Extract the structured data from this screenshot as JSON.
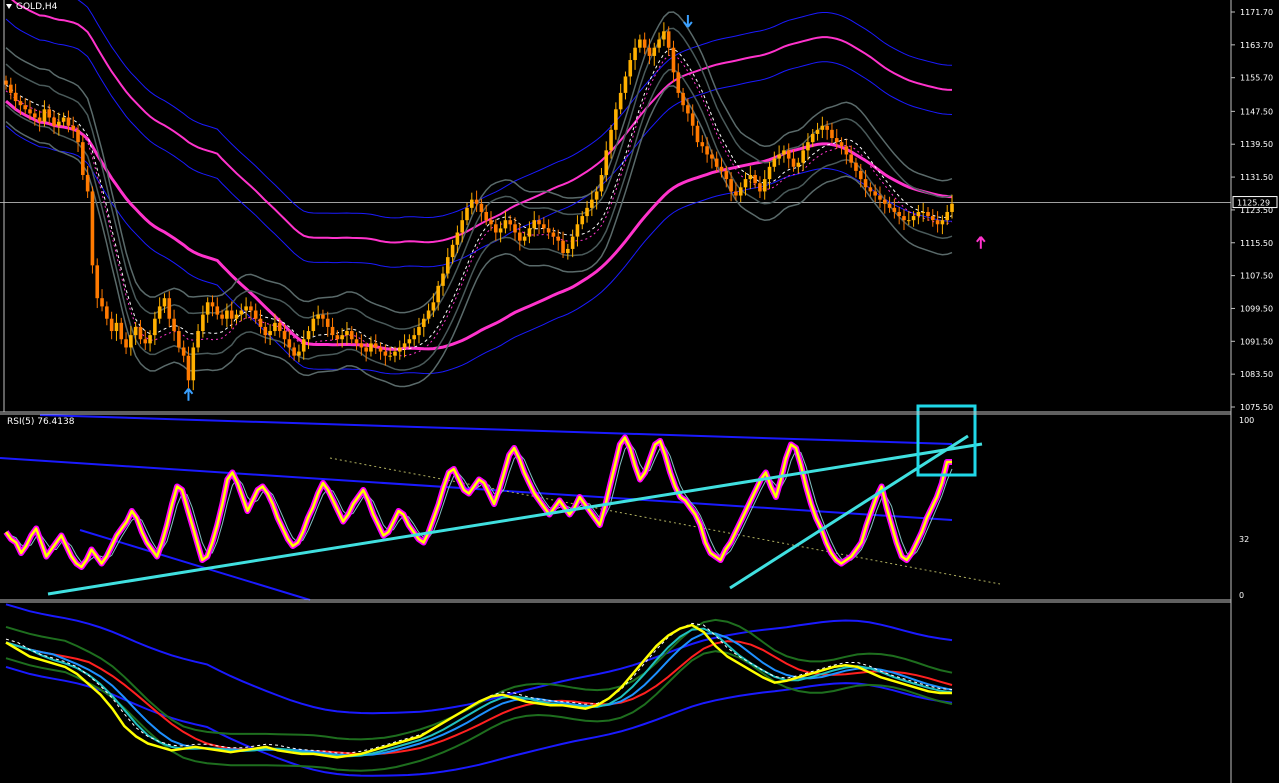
{
  "header": {
    "symbol": "GOLD,H4",
    "rsi_label": "RSI(5) 76.4138"
  },
  "colors": {
    "background": "#000000",
    "grid_frame": "#c0c0c0",
    "candle_up": "#ffb000",
    "candle_down": "#ff7a00",
    "envelope_magenta": "#ff33cc",
    "band_blue": "#1a1aff",
    "band_gray": "#5a6a6a",
    "rsi_yellow": "#ffff00",
    "rsi_magenta": "#ff00ff",
    "trend_cyan": "#40e0e0",
    "osc_red": "#ff2020",
    "osc_green": "#1e6e1e"
  },
  "chart_data": [
    {
      "type": "candlestick",
      "title": "GOLD,H4",
      "ylim": [
        1075.5,
        1171.7
      ],
      "price_ticks": [
        "1171.70",
        "1163.70",
        "1155.70",
        "1147.50",
        "1139.50",
        "1131.50",
        "1123.50",
        "1115.50",
        "1107.50",
        "1099.50",
        "1091.50",
        "1083.50",
        "1075.50"
      ],
      "current_price": "1125.29",
      "close_path": [
        1154,
        1152,
        1150,
        1149,
        1148,
        1147,
        1146,
        1145,
        1148,
        1146,
        1144,
        1145,
        1146,
        1144,
        1143,
        1140,
        1132,
        1128,
        1110,
        1102,
        1100,
        1097,
        1094,
        1096,
        1092,
        1090,
        1093,
        1095,
        1092,
        1091,
        1093,
        1097,
        1100,
        1102,
        1097,
        1094,
        1090,
        1088,
        1082,
        1090,
        1094,
        1098,
        1101,
        1100,
        1098,
        1097,
        1099,
        1097,
        1098,
        1099,
        1100,
        1099,
        1097,
        1095,
        1093,
        1094,
        1096,
        1094,
        1092,
        1090,
        1088,
        1089,
        1092,
        1094,
        1097,
        1098,
        1097,
        1095,
        1093,
        1092,
        1093,
        1094,
        1092,
        1091,
        1090,
        1089,
        1091,
        1090,
        1089,
        1088,
        1088,
        1089,
        1090,
        1091,
        1092,
        1093,
        1095,
        1097,
        1099,
        1101,
        1105,
        1108,
        1112,
        1115,
        1118,
        1121,
        1124,
        1126,
        1125,
        1123,
        1121,
        1120,
        1118,
        1119,
        1121,
        1120,
        1118,
        1116,
        1117,
        1119,
        1121,
        1120,
        1119,
        1118,
        1117,
        1116,
        1113,
        1114,
        1117,
        1120,
        1122,
        1124,
        1126,
        1128,
        1132,
        1138,
        1143,
        1148,
        1152,
        1156,
        1160,
        1163,
        1165,
        1163,
        1161,
        1163,
        1165,
        1167,
        1163,
        1157,
        1152,
        1149,
        1147,
        1144,
        1140,
        1139,
        1137,
        1136,
        1134,
        1133,
        1131,
        1128,
        1127,
        1129,
        1131,
        1132,
        1130,
        1128,
        1131,
        1134,
        1136,
        1137,
        1138,
        1136,
        1134,
        1135,
        1138,
        1140,
        1142,
        1143,
        1144,
        1143,
        1141,
        1140,
        1139,
        1137,
        1135,
        1133,
        1131,
        1129,
        1128,
        1127,
        1126,
        1125,
        1124,
        1123,
        1122,
        1121,
        1121,
        1122,
        1123,
        1123,
        1122,
        1121,
        1120,
        1121,
        1123,
        1125
      ],
      "markers": [
        {
          "type": "buy-arrow",
          "bar": 38,
          "price": 1078
        },
        {
          "type": "sell-arrow",
          "bar": 142,
          "price": 1170
        },
        {
          "type": "buy-arrow",
          "bar": 203,
          "price": 1115
        }
      ]
    },
    {
      "type": "line",
      "title": "RSI(5) 76.4138",
      "ylim": [
        0,
        100
      ],
      "levels": [
        "100",
        "32",
        "0"
      ],
      "series": [
        {
          "values": [
            36,
            32,
            30,
            24,
            28,
            34,
            38,
            30,
            22,
            26,
            30,
            34,
            28,
            22,
            18,
            16,
            20,
            26,
            22,
            18,
            22,
            28,
            34,
            38,
            42,
            48,
            44,
            36,
            30,
            26,
            22,
            30,
            40,
            52,
            62,
            60,
            50,
            40,
            30,
            20,
            22,
            30,
            40,
            52,
            66,
            70,
            64,
            56,
            48,
            54,
            60,
            62,
            58,
            52,
            44,
            38,
            32,
            28,
            30,
            36,
            44,
            50,
            58,
            64,
            60,
            54,
            48,
            42,
            46,
            52,
            56,
            60,
            54,
            46,
            40,
            34,
            36,
            42,
            48,
            46,
            40,
            36,
            32,
            30,
            36,
            44,
            52,
            62,
            70,
            72,
            66,
            60,
            58,
            62,
            66,
            64,
            58,
            52,
            60,
            70,
            80,
            84,
            78,
            70,
            64,
            58,
            54,
            50,
            46,
            50,
            54,
            50,
            46,
            50,
            56,
            52,
            48,
            44,
            40,
            50,
            62,
            74,
            86,
            90,
            84,
            74,
            66,
            70,
            78,
            86,
            88,
            80,
            70,
            62,
            56,
            54,
            50,
            46,
            40,
            30,
            24,
            22,
            20,
            26,
            30,
            36,
            42,
            48,
            54,
            60,
            66,
            70,
            62,
            56,
            66,
            78,
            86,
            84,
            74,
            62,
            52,
            44,
            38,
            30,
            24,
            20,
            18,
            20,
            22,
            26,
            30,
            40,
            48,
            56,
            62,
            50,
            40,
            30,
            22,
            20,
            24,
            30,
            36,
            44,
            50,
            56,
            64,
            76,
            76
          ]
        }
      ]
    },
    {
      "type": "line",
      "title": "",
      "ylim": [
        1075,
        1175
      ],
      "series": [
        {
          "values": [
            1154,
            1150,
            1146,
            1144,
            1142,
            1140,
            1136,
            1130,
            1124,
            1116,
            1106,
            1100,
            1096,
            1094,
            1092,
            1093,
            1094,
            1093,
            1092,
            1091,
            1092,
            1093,
            1094,
            1092,
            1091,
            1090,
            1090,
            1089,
            1088,
            1089,
            1090,
            1092,
            1094,
            1096,
            1098,
            1100,
            1104,
            1108,
            1112,
            1116,
            1120,
            1123,
            1124,
            1122,
            1120,
            1119,
            1118,
            1118,
            1117,
            1116,
            1118,
            1122,
            1128,
            1136,
            1144,
            1152,
            1158,
            1162,
            1164,
            1160,
            1152,
            1146,
            1142,
            1138,
            1134,
            1131,
            1132,
            1134,
            1136,
            1138,
            1140,
            1141,
            1140,
            1137,
            1134,
            1132,
            1130,
            1128,
            1126,
            1125,
            1125
          ]
        }
      ]
    }
  ]
}
